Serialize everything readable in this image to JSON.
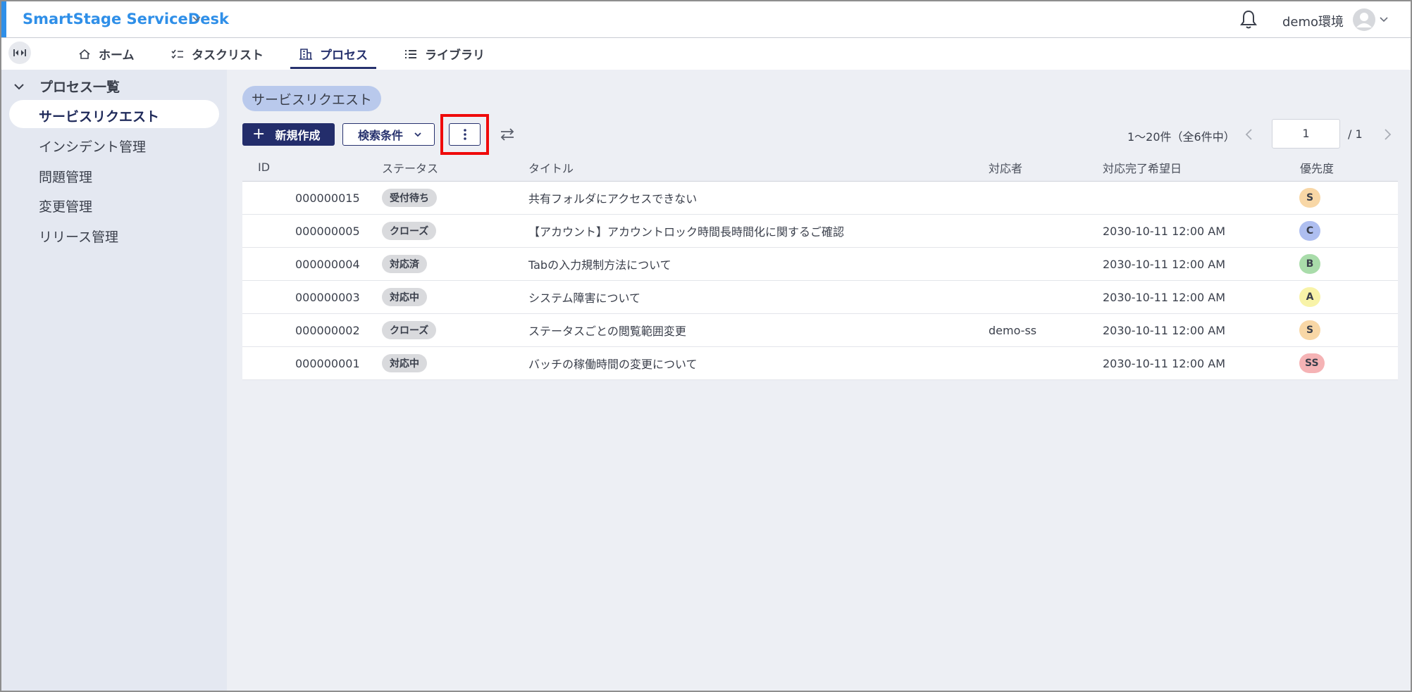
{
  "header": {
    "brand": "SmartStage ServiceDesk",
    "environment": "demo環境"
  },
  "nav": {
    "tabs": [
      {
        "label": "ホーム",
        "icon": "home-icon"
      },
      {
        "label": "タスクリスト",
        "icon": "checklist-icon"
      },
      {
        "label": "プロセス",
        "icon": "building-icon",
        "active": true
      },
      {
        "label": "ライブラリ",
        "icon": "list-icon"
      }
    ]
  },
  "sidebar": {
    "group_label": "プロセス一覧",
    "items": [
      {
        "label": "サービスリクエスト",
        "active": true
      },
      {
        "label": "インシデント管理"
      },
      {
        "label": "問題管理"
      },
      {
        "label": "変更管理"
      },
      {
        "label": "リリース管理"
      }
    ]
  },
  "main": {
    "section_chip": "サービスリクエスト",
    "new_button": "新規作成",
    "search_button": "検索条件",
    "pagination": {
      "range_text": "1〜20件（全6件中）",
      "current_page": "1",
      "total_text": "/ 1"
    },
    "table": {
      "headers": [
        "ID",
        "ステータス",
        "タイトル",
        "対応者",
        "対応完了希望日",
        "優先度"
      ],
      "rows": [
        {
          "id": "000000015",
          "status": "受付待ち",
          "title": "共有フォルダにアクセスできない",
          "assignee": "",
          "due": "",
          "priority": "S",
          "priority_color": "#f8d7a6"
        },
        {
          "id": "000000005",
          "status": "クローズ",
          "title": "【アカウント】アカウントロック時間長時間化に関するご確認",
          "assignee": "",
          "due": "2030-10-11 12:00 AM",
          "priority": "C",
          "priority_color": "#aebef0"
        },
        {
          "id": "000000004",
          "status": "対応済",
          "title": "Tabの入力規制方法について",
          "assignee": "",
          "due": "2030-10-11 12:00 AM",
          "priority": "B",
          "priority_color": "#a9dcaa"
        },
        {
          "id": "000000003",
          "status": "対応中",
          "title": "システム障害について",
          "assignee": "",
          "due": "2030-10-11 12:00 AM",
          "priority": "A",
          "priority_color": "#f8f3a8"
        },
        {
          "id": "000000002",
          "status": "クローズ",
          "title": "ステータスごとの閲覧範囲変更",
          "assignee": "demo-ss",
          "due": "2030-10-11 12:00 AM",
          "priority": "S",
          "priority_color": "#f8d7a6"
        },
        {
          "id": "000000001",
          "status": "対応中",
          "title": "バッチの稼働時間の変更について",
          "assignee": "",
          "due": "2030-10-11 12:00 AM",
          "priority": "SS",
          "priority_color": "#f5b3b5"
        }
      ]
    }
  },
  "colors": {
    "brand": "#2f8fe8",
    "primary": "#232d6b",
    "highlight": "#ef0a0a"
  }
}
